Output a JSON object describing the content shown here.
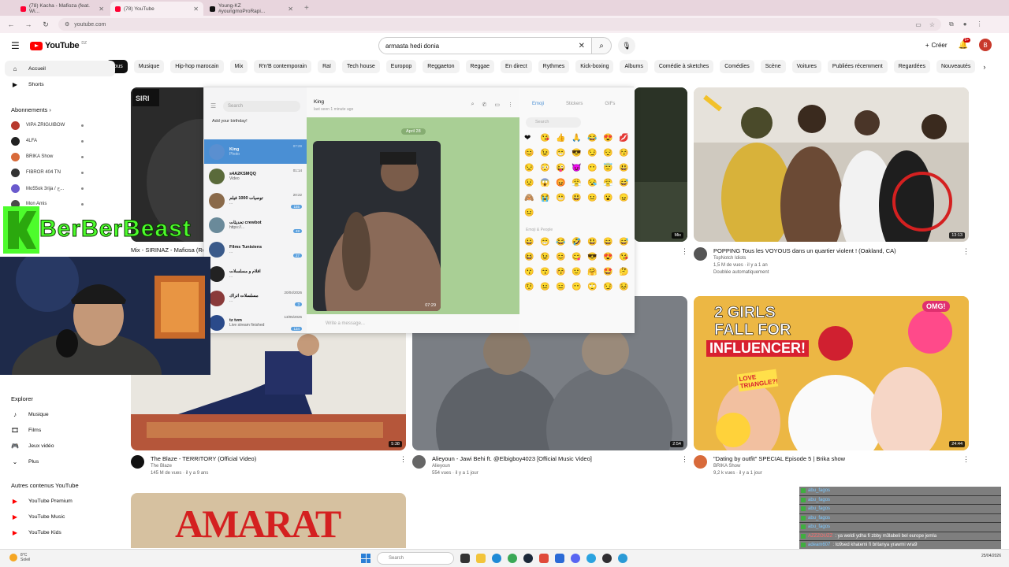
{
  "browser": {
    "tabs": [
      {
        "title": "(78) Kacha - Mafioza (feat. Wi...",
        "active": false,
        "icon": "youtube"
      },
      {
        "title": "(78) YouTube",
        "active": true,
        "icon": "youtube"
      },
      {
        "title": "Young-KZ #youngmoProRapi...",
        "active": false,
        "icon": "tiktok"
      }
    ],
    "url": "youtube.com"
  },
  "header": {
    "logo": "YouTube",
    "logo_region": "DZ",
    "search_value": "armasta hedi donia",
    "create_label": "Créer",
    "notif_count": "9+",
    "avatar_letter": "B"
  },
  "chips": [
    "Tous",
    "Musique",
    "Hip-hop marocain",
    "Mix",
    "R'n'B contemporain",
    "Raï",
    "Tech house",
    "Europop",
    "Reggaeton",
    "Reggae",
    "En direct",
    "Rythmes",
    "Kick-boxing",
    "Albums",
    "Comédie à sketches",
    "Comédies",
    "Scène",
    "Voitures",
    "Publiées récemment",
    "Regardées",
    "Nouveautés"
  ],
  "sidebar": {
    "main": [
      {
        "label": "Accueil",
        "icon": "home-icon"
      },
      {
        "label": "Shorts",
        "icon": "shorts-icon"
      }
    ],
    "subs_header": "Abonnements",
    "subs": [
      {
        "label": "VIPA ZRIGUIBOW",
        "color": "#b83a2e"
      },
      {
        "label": "4LFA",
        "color": "#222222"
      },
      {
        "label": "BRIKA Show",
        "color": "#d86a3a"
      },
      {
        "label": "FIBROR 404 TN",
        "color": "#333333"
      },
      {
        "label": "Mo55ok 3rija / ح...",
        "color": "#6a5acd"
      },
      {
        "label": "Mon Amis",
        "color": "#4a4a4a"
      }
    ],
    "explore_header": "Explorer",
    "explore": [
      {
        "label": "Musique",
        "icon": "music-icon"
      },
      {
        "label": "Films",
        "icon": "film-icon"
      },
      {
        "label": "Jeux vidéo",
        "icon": "gamepad-icon"
      },
      {
        "label": "Plus",
        "icon": "chevron-down-icon"
      }
    ],
    "more_header": "Autres contenus YouTube",
    "more": [
      {
        "label": "YouTube Premium"
      },
      {
        "label": "YouTube Music"
      },
      {
        "label": "YouTube Kids"
      }
    ]
  },
  "videos": [
    {
      "title": "Mix - SIRINAZ - Mafiosa (Remix)",
      "channel": "",
      "stats": "",
      "duration": "",
      "thumb": "#1c1c1c"
    },
    {
      "title": "",
      "channel": "",
      "stats": "",
      "duration": "Mix",
      "thumb": "#2e3a2a"
    },
    {
      "title": "POPPING Tous les VOYOUS dans un quartier violent ! (Oakland, CA)",
      "channel": "TopNotch Idiots",
      "stats": "1,5 M de vues · il y a 1 an",
      "extra": "Doublée automatiquement",
      "duration": "13:13",
      "thumb": "#c9c2b5"
    },
    {
      "title": "The Blaze - TERRITORY (Official Video)",
      "channel": "The Blaze",
      "stats": "145 M de vues · il y a 9 ans",
      "duration": "5:38",
      "thumb": "#4a3a2c"
    },
    {
      "title": "Alieyoun - Jawi Behi ft. @Elbigboy4023 [Official Music Video]",
      "channel": "Alieyoun",
      "stats": "554 vues · il y a 1 jour",
      "duration": "2:54",
      "thumb": "#6b7078"
    },
    {
      "title": "\"Dating by outfit\" SPECIAL Episode 5 | Brika show",
      "channel": "BRIKA Show",
      "stats": "9,2 k vues · il y a 1 jour",
      "duration": "24:44",
      "thumb": "#e0b24a"
    }
  ],
  "bottom_thumb_text": "AMARAT",
  "thumb_texts": {
    "girls": "2 GIRLS",
    "fall": "FALL FOR",
    "influencer": "INFLUENCER!",
    "omg": "OMG!",
    "love": "LOVE TRIANGLE?!"
  },
  "telegram": {
    "search_placeholder": "Search",
    "birthday": "Add your birthday!",
    "chat_name": "King",
    "chat_status": "last seen 1 minute ago",
    "date_badge": "April 28",
    "photo_time": "07:29",
    "input_placeholder": "Write a message...",
    "emoji_tabs": [
      "Emoji",
      "Stickers",
      "GIFs"
    ],
    "emoji_search": "Search",
    "people_label": "Emoji & People",
    "chats": [
      {
        "name": "King",
        "preview": "Photo",
        "time": "07:29",
        "count": "",
        "color": "#5a8fd0"
      },
      {
        "name": "s4A2KSMQQ",
        "preview": "Video",
        "time": "01:14",
        "count": "",
        "color": "#5a6a3a"
      },
      {
        "name": "توصيات 1000 فيلم",
        "preview": "...",
        "time": "20:22",
        "count": "155",
        "color": "#8a6a4a"
      },
      {
        "name": "تحديثات crewbot",
        "preview": "https://...",
        "time": "",
        "count": "48",
        "color": "#6a8a9a"
      },
      {
        "name": "Films Tunisiens",
        "preview": "...",
        "time": "",
        "count": "27",
        "color": "#3a5a8a"
      },
      {
        "name": "افلام و مسلسلات",
        "preview": "...",
        "time": "",
        "count": "",
        "color": "#222222"
      },
      {
        "name": "مسلسلات اتراك",
        "preview": "...",
        "time": "20/04/2026",
        "count": "3",
        "color": "#8a3a3a"
      },
      {
        "name": "tz tvm",
        "preview": "Live stream finished",
        "time": "13/05/2026",
        "count": "134",
        "color": "#2a4a8a"
      }
    ],
    "emoji_rows_top": [
      "❤️😘👍🙏😂😍💋",
      "😊😉😁😎😏😌😚",
      "😒😳😜😈😶😇😃",
      "😟😱😡😤😪😤😅",
      "🙈😭😬😃😐😮😠",
      "😐"
    ],
    "emoji_rows_people": [
      "😀😁😂🤣😃😄😅",
      "😆😉😊😋😎😍😘",
      "😗😙😚🙂🤗🤩🤔",
      "🤨😐😑😶🙄😏😣"
    ]
  },
  "stream": {
    "brand": "BerBerBeast"
  },
  "chat": [
    {
      "user": "abu_fagos",
      "msg": "",
      "red": false
    },
    {
      "user": "abu_fagos",
      "msg": "",
      "red": false
    },
    {
      "user": "abu_fagos",
      "msg": "",
      "red": false
    },
    {
      "user": "abu_fagos",
      "msg": "",
      "red": false
    },
    {
      "user": "abu_fagos",
      "msg": "",
      "red": false
    },
    {
      "user": "AZZZOUZZ",
      "msg": ": ya weldi ydha fi zbby m3labeli bel europe jemla",
      "red": true
    },
    {
      "user": "adeam607",
      "msg": ": to9sed khatemi fi britanya yrawmi wra9",
      "red": false
    }
  ],
  "taskbar": {
    "weather_temp": "8°C",
    "weather_desc": "Soleil",
    "search": "Search",
    "time": "",
    "date": "25/04/2026"
  }
}
